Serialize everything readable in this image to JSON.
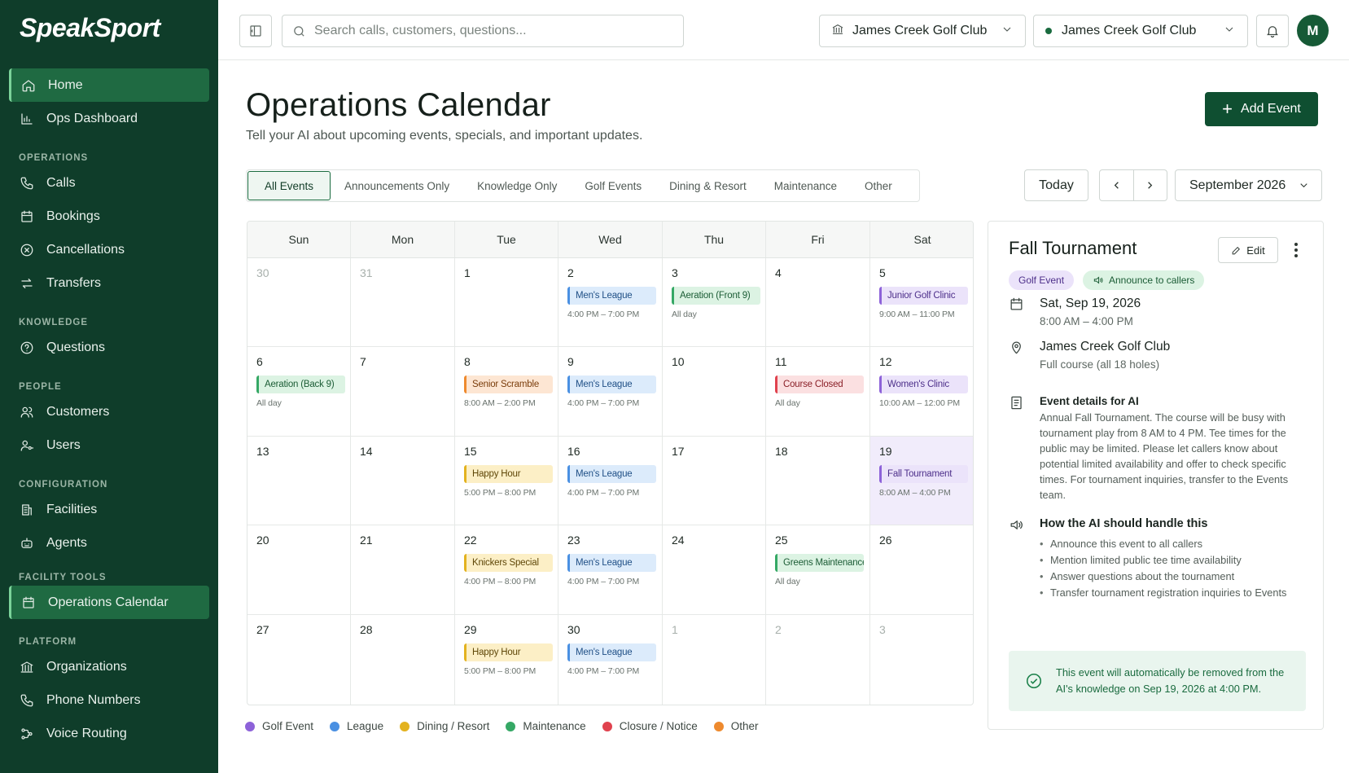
{
  "brand": "SpeakSport",
  "sidebar": {
    "home": "Home",
    "ops_dashboard": "Ops Dashboard",
    "sec_operations": "OPERATIONS",
    "calls": "Calls",
    "bookings": "Bookings",
    "cancellations": "Cancellations",
    "transfers": "Transfers",
    "sec_knowledge": "KNOWLEDGE",
    "questions": "Questions",
    "sec_people": "PEOPLE",
    "customers": "Customers",
    "users": "Users",
    "sec_configuration": "CONFIGURATION",
    "facilities": "Facilities",
    "agents": "Agents",
    "sec_facility_tools": "FACILITY TOOLS",
    "operations_calendar": "Operations Calendar",
    "sec_platform": "PLATFORM",
    "organizations": "Organizations",
    "phone_numbers": "Phone Numbers",
    "voice_routing": "Voice Routing"
  },
  "topbar": {
    "search_placeholder": "Search calls, customers, questions...",
    "org": "James Creek Golf Club",
    "location": "James Creek Golf Club",
    "avatar": "M"
  },
  "page": {
    "title": "Operations Calendar",
    "subtitle": "Tell your AI about upcoming events, specials, and important updates.",
    "add_event": "Add Event"
  },
  "filters": [
    "All Events",
    "Announcements Only",
    "Knowledge Only",
    "Golf Events",
    "Dining & Resort",
    "Maintenance",
    "Other"
  ],
  "controls": {
    "today": "Today",
    "month": "September 2026"
  },
  "weekdays": [
    "Sun",
    "Mon",
    "Tue",
    "Wed",
    "Thu",
    "Fri",
    "Sat"
  ],
  "weeks": [
    [
      {
        "day": "30",
        "muted": true,
        "events": []
      },
      {
        "day": "31",
        "muted": true,
        "events": []
      },
      {
        "day": "1",
        "events": []
      },
      {
        "day": "2",
        "events": [
          {
            "title": "Men's League",
            "time": "4:00 PM – 7:00 PM",
            "cat": "league"
          }
        ]
      },
      {
        "day": "3",
        "events": [
          {
            "title": "Aeration (Front 9)",
            "time": "All day",
            "cat": "maint"
          }
        ]
      },
      {
        "day": "4",
        "events": []
      },
      {
        "day": "5",
        "events": [
          {
            "title": "Junior Golf Clinic",
            "time": "9:00 AM – 11:00 PM",
            "cat": "golf"
          }
        ]
      }
    ],
    [
      {
        "day": "6",
        "events": [
          {
            "title": "Aeration (Back 9)",
            "time": "All day",
            "cat": "maint"
          }
        ]
      },
      {
        "day": "7",
        "events": []
      },
      {
        "day": "8",
        "events": [
          {
            "title": "Senior Scramble",
            "time": "8:00 AM – 2:00 PM",
            "cat": "other"
          }
        ]
      },
      {
        "day": "9",
        "events": [
          {
            "title": "Men's League",
            "time": "4:00 PM – 7:00 PM",
            "cat": "league"
          }
        ]
      },
      {
        "day": "10",
        "events": []
      },
      {
        "day": "11",
        "events": [
          {
            "title": "Course Closed",
            "time": "All day",
            "cat": "closure"
          }
        ]
      },
      {
        "day": "12",
        "events": [
          {
            "title": "Women's Clinic",
            "time": "10:00 AM – 12:00 PM",
            "cat": "golf"
          }
        ]
      }
    ],
    [
      {
        "day": "13",
        "events": []
      },
      {
        "day": "14",
        "events": []
      },
      {
        "day": "15",
        "events": [
          {
            "title": "Happy Hour",
            "time": "5:00 PM – 8:00 PM",
            "cat": "dining"
          }
        ]
      },
      {
        "day": "16",
        "events": [
          {
            "title": "Men's League",
            "time": "4:00 PM – 7:00 PM",
            "cat": "league"
          }
        ]
      },
      {
        "day": "17",
        "events": []
      },
      {
        "day": "18",
        "events": []
      },
      {
        "day": "19",
        "selected": true,
        "events": [
          {
            "title": "Fall Tournament",
            "time": "8:00 AM – 4:00 PM",
            "cat": "golf"
          }
        ]
      }
    ],
    [
      {
        "day": "20",
        "events": []
      },
      {
        "day": "21",
        "events": []
      },
      {
        "day": "22",
        "events": [
          {
            "title": "Knickers Special",
            "time": "4:00 PM – 8:00 PM",
            "cat": "dining"
          }
        ]
      },
      {
        "day": "23",
        "events": [
          {
            "title": "Men's League",
            "time": "4:00 PM – 7:00 PM",
            "cat": "league"
          }
        ]
      },
      {
        "day": "24",
        "events": []
      },
      {
        "day": "25",
        "events": [
          {
            "title": "Greens Maintenance",
            "time": "All day",
            "cat": "maint"
          }
        ]
      },
      {
        "day": "26",
        "events": []
      }
    ],
    [
      {
        "day": "27",
        "events": []
      },
      {
        "day": "28",
        "events": []
      },
      {
        "day": "29",
        "events": [
          {
            "title": "Happy Hour",
            "time": "5:00 PM – 8:00 PM",
            "cat": "dining"
          }
        ]
      },
      {
        "day": "30",
        "events": [
          {
            "title": "Men's League",
            "time": "4:00 PM – 7:00 PM",
            "cat": "league"
          }
        ]
      },
      {
        "day": "1",
        "muted": true,
        "events": []
      },
      {
        "day": "2",
        "muted": true,
        "events": []
      },
      {
        "day": "3",
        "muted": true,
        "events": []
      }
    ]
  ],
  "legend": [
    {
      "label": "Golf Event",
      "color": "#8d62d9"
    },
    {
      "label": "League",
      "color": "#4a90e2"
    },
    {
      "label": "Dining / Resort",
      "color": "#e3b21f"
    },
    {
      "label": "Maintenance",
      "color": "#35a865"
    },
    {
      "label": "Closure / Notice",
      "color": "#e0424e"
    },
    {
      "label": "Other",
      "color": "#ee8a2e"
    }
  ],
  "detail": {
    "title": "Fall Tournament",
    "edit": "Edit",
    "tag_category": "Golf Event",
    "tag_announce": "Announce to callers",
    "date": "Sat, Sep 19, 2026",
    "time": "8:00 AM – 4:00 PM",
    "location": "James Creek Golf Club",
    "location_sub": "Full course (all 18 holes)",
    "details_heading": "Event details for AI",
    "details_text": "Annual Fall Tournament. The course will be busy with tournament play from 8 AM to 4 PM. Tee times for the public may be limited. Please let callers know about potential limited availability and offer to check specific times. For tournament inquiries, transfer to the Events team.",
    "handle_heading": "How the AI should handle this",
    "handle_items": [
      "Announce this event to all callers",
      "Mention limited public tee time availability",
      "Answer questions about the tournament",
      "Transfer tournament registration inquiries to Events"
    ],
    "notice": "This event will automatically be removed from the AI's knowledge on Sep 19, 2026 at 4:00 PM."
  }
}
